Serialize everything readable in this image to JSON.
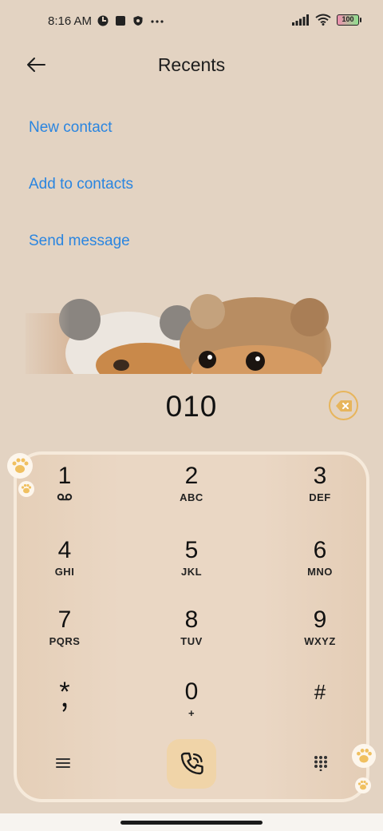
{
  "status_bar": {
    "time": "8:16 AM",
    "battery": "100"
  },
  "header": {
    "title": "Recents",
    "back_icon": "arrow-left-icon"
  },
  "actions": [
    {
      "label": "New contact"
    },
    {
      "label": "Add to contacts"
    },
    {
      "label": "Send message"
    }
  ],
  "dialer": {
    "number": "010",
    "backspace_icon": "backspace-icon"
  },
  "keys": [
    {
      "digit": "1",
      "letters": ""
    },
    {
      "digit": "2",
      "letters": "ABC"
    },
    {
      "digit": "3",
      "letters": "DEF"
    },
    {
      "digit": "4",
      "letters": "GHI"
    },
    {
      "digit": "5",
      "letters": "JKL"
    },
    {
      "digit": "6",
      "letters": "MNO"
    },
    {
      "digit": "7",
      "letters": "PQRS"
    },
    {
      "digit": "8",
      "letters": "TUV"
    },
    {
      "digit": "9",
      "letters": "WXYZ"
    },
    {
      "digit": "*",
      "letters": ""
    },
    {
      "digit": "0",
      "letters": "+"
    },
    {
      "digit": "#",
      "letters": ""
    }
  ],
  "bottom": {
    "menu_icon": "menu-icon",
    "call_icon": "phone-icon",
    "dialpad_icon": "dialpad-icon"
  },
  "colors": {
    "background": "#e3d3c2",
    "link": "#2a85e0",
    "accent": "#e7b55c",
    "call_button": "#f0d4a8"
  }
}
